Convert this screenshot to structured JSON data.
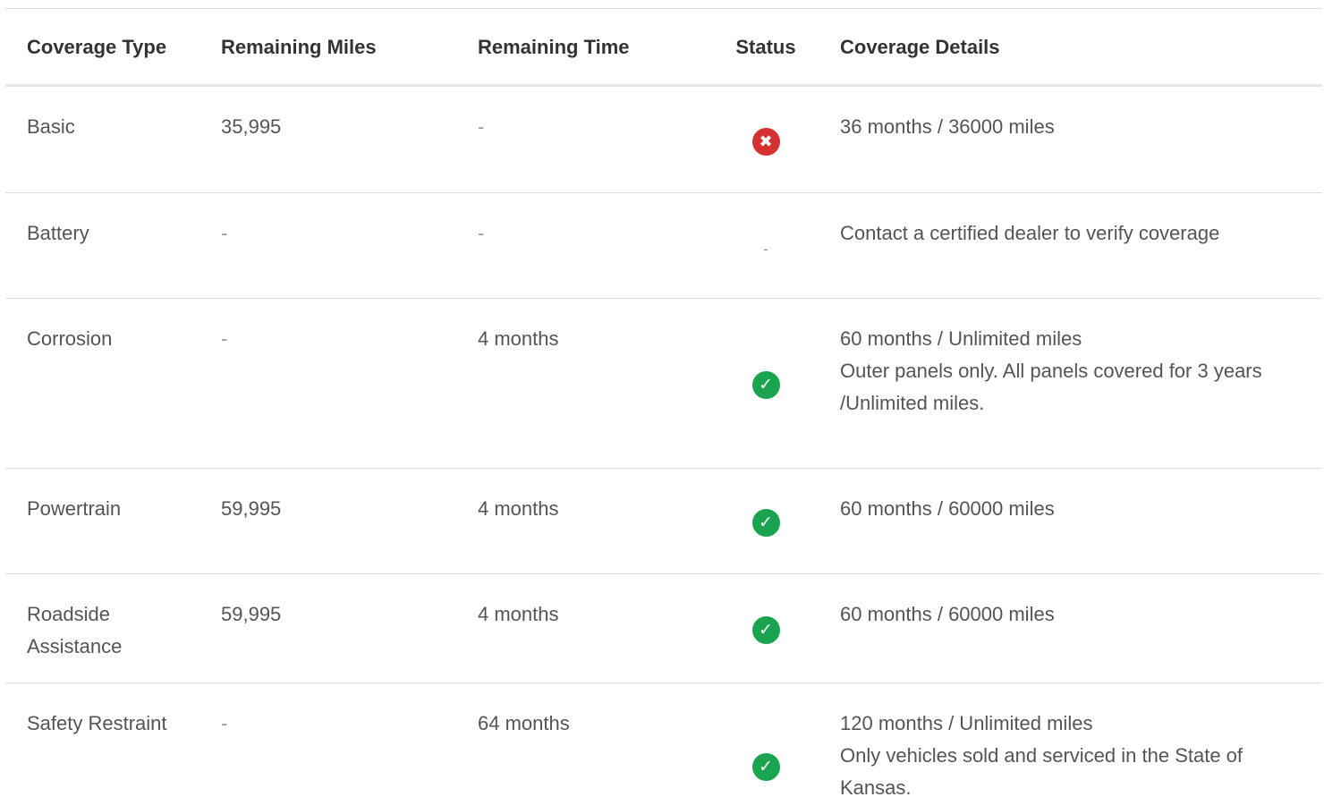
{
  "table": {
    "headers": {
      "coverage_type": "Coverage Type",
      "remaining_miles": "Remaining Miles",
      "remaining_time": "Remaining Time",
      "status": "Status",
      "coverage_details": "Coverage Details"
    },
    "rows": [
      {
        "coverage_type": "Basic",
        "remaining_miles": "35,995",
        "remaining_time": "-",
        "status": "expired",
        "status_icon": "x-circle-icon",
        "status_glyph": "✖",
        "details_line1": "36 months / 36000 miles",
        "details_line2": ""
      },
      {
        "coverage_type": "Battery",
        "remaining_miles": "-",
        "remaining_time": "-",
        "status": "unknown",
        "status_text": "-",
        "details_line1": "Contact a certified dealer to verify coverage",
        "details_line2": ""
      },
      {
        "coverage_type": "Corrosion",
        "remaining_miles": "-",
        "remaining_time": "4 months",
        "status": "active",
        "status_icon": "check-circle-icon",
        "status_glyph": "✓",
        "details_line1": "60 months / Unlimited miles",
        "details_line2": "Outer panels only. All panels covered for 3 years /Unlimited miles."
      },
      {
        "coverage_type": "Powertrain",
        "remaining_miles": "59,995",
        "remaining_time": "4 months",
        "status": "active",
        "status_icon": "check-circle-icon",
        "status_glyph": "✓",
        "details_line1": "60 months / 60000 miles",
        "details_line2": ""
      },
      {
        "coverage_type": "Roadside Assistance",
        "remaining_miles": "59,995",
        "remaining_time": "4 months",
        "status": "active",
        "status_icon": "check-circle-icon",
        "status_glyph": "✓",
        "details_line1": "60 months / 60000 miles",
        "details_line2": ""
      },
      {
        "coverage_type": "Safety Restraint",
        "remaining_miles": "-",
        "remaining_time": "64 months",
        "status": "active",
        "status_icon": "check-circle-icon",
        "status_glyph": "✓",
        "details_line1": "120 months / Unlimited miles",
        "details_line2": "Only vehicles sold and serviced in the State of Kansas."
      }
    ]
  },
  "colors": {
    "active": "#1aa44f",
    "expired": "#d63131"
  }
}
